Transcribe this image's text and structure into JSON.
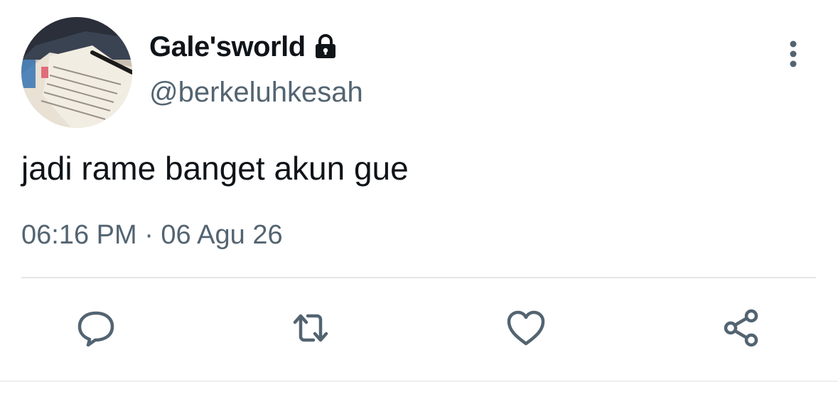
{
  "tweet": {
    "display_name": "Gale'sworld",
    "handle": "@berkeluhkesah",
    "text": "jadi rame banget akun gue",
    "timestamp": "06:16 PM · 06 Agu 26",
    "protected": true
  },
  "icons": {
    "lock": "lock-icon",
    "more": "more-vertical-icon",
    "reply": "reply-icon",
    "retweet": "retweet-icon",
    "like": "heart-icon",
    "share": "share-icon"
  },
  "colors": {
    "text_primary": "#0f1419",
    "text_secondary": "#536471",
    "icon": "#536471",
    "divider": "#e6e6e6"
  }
}
